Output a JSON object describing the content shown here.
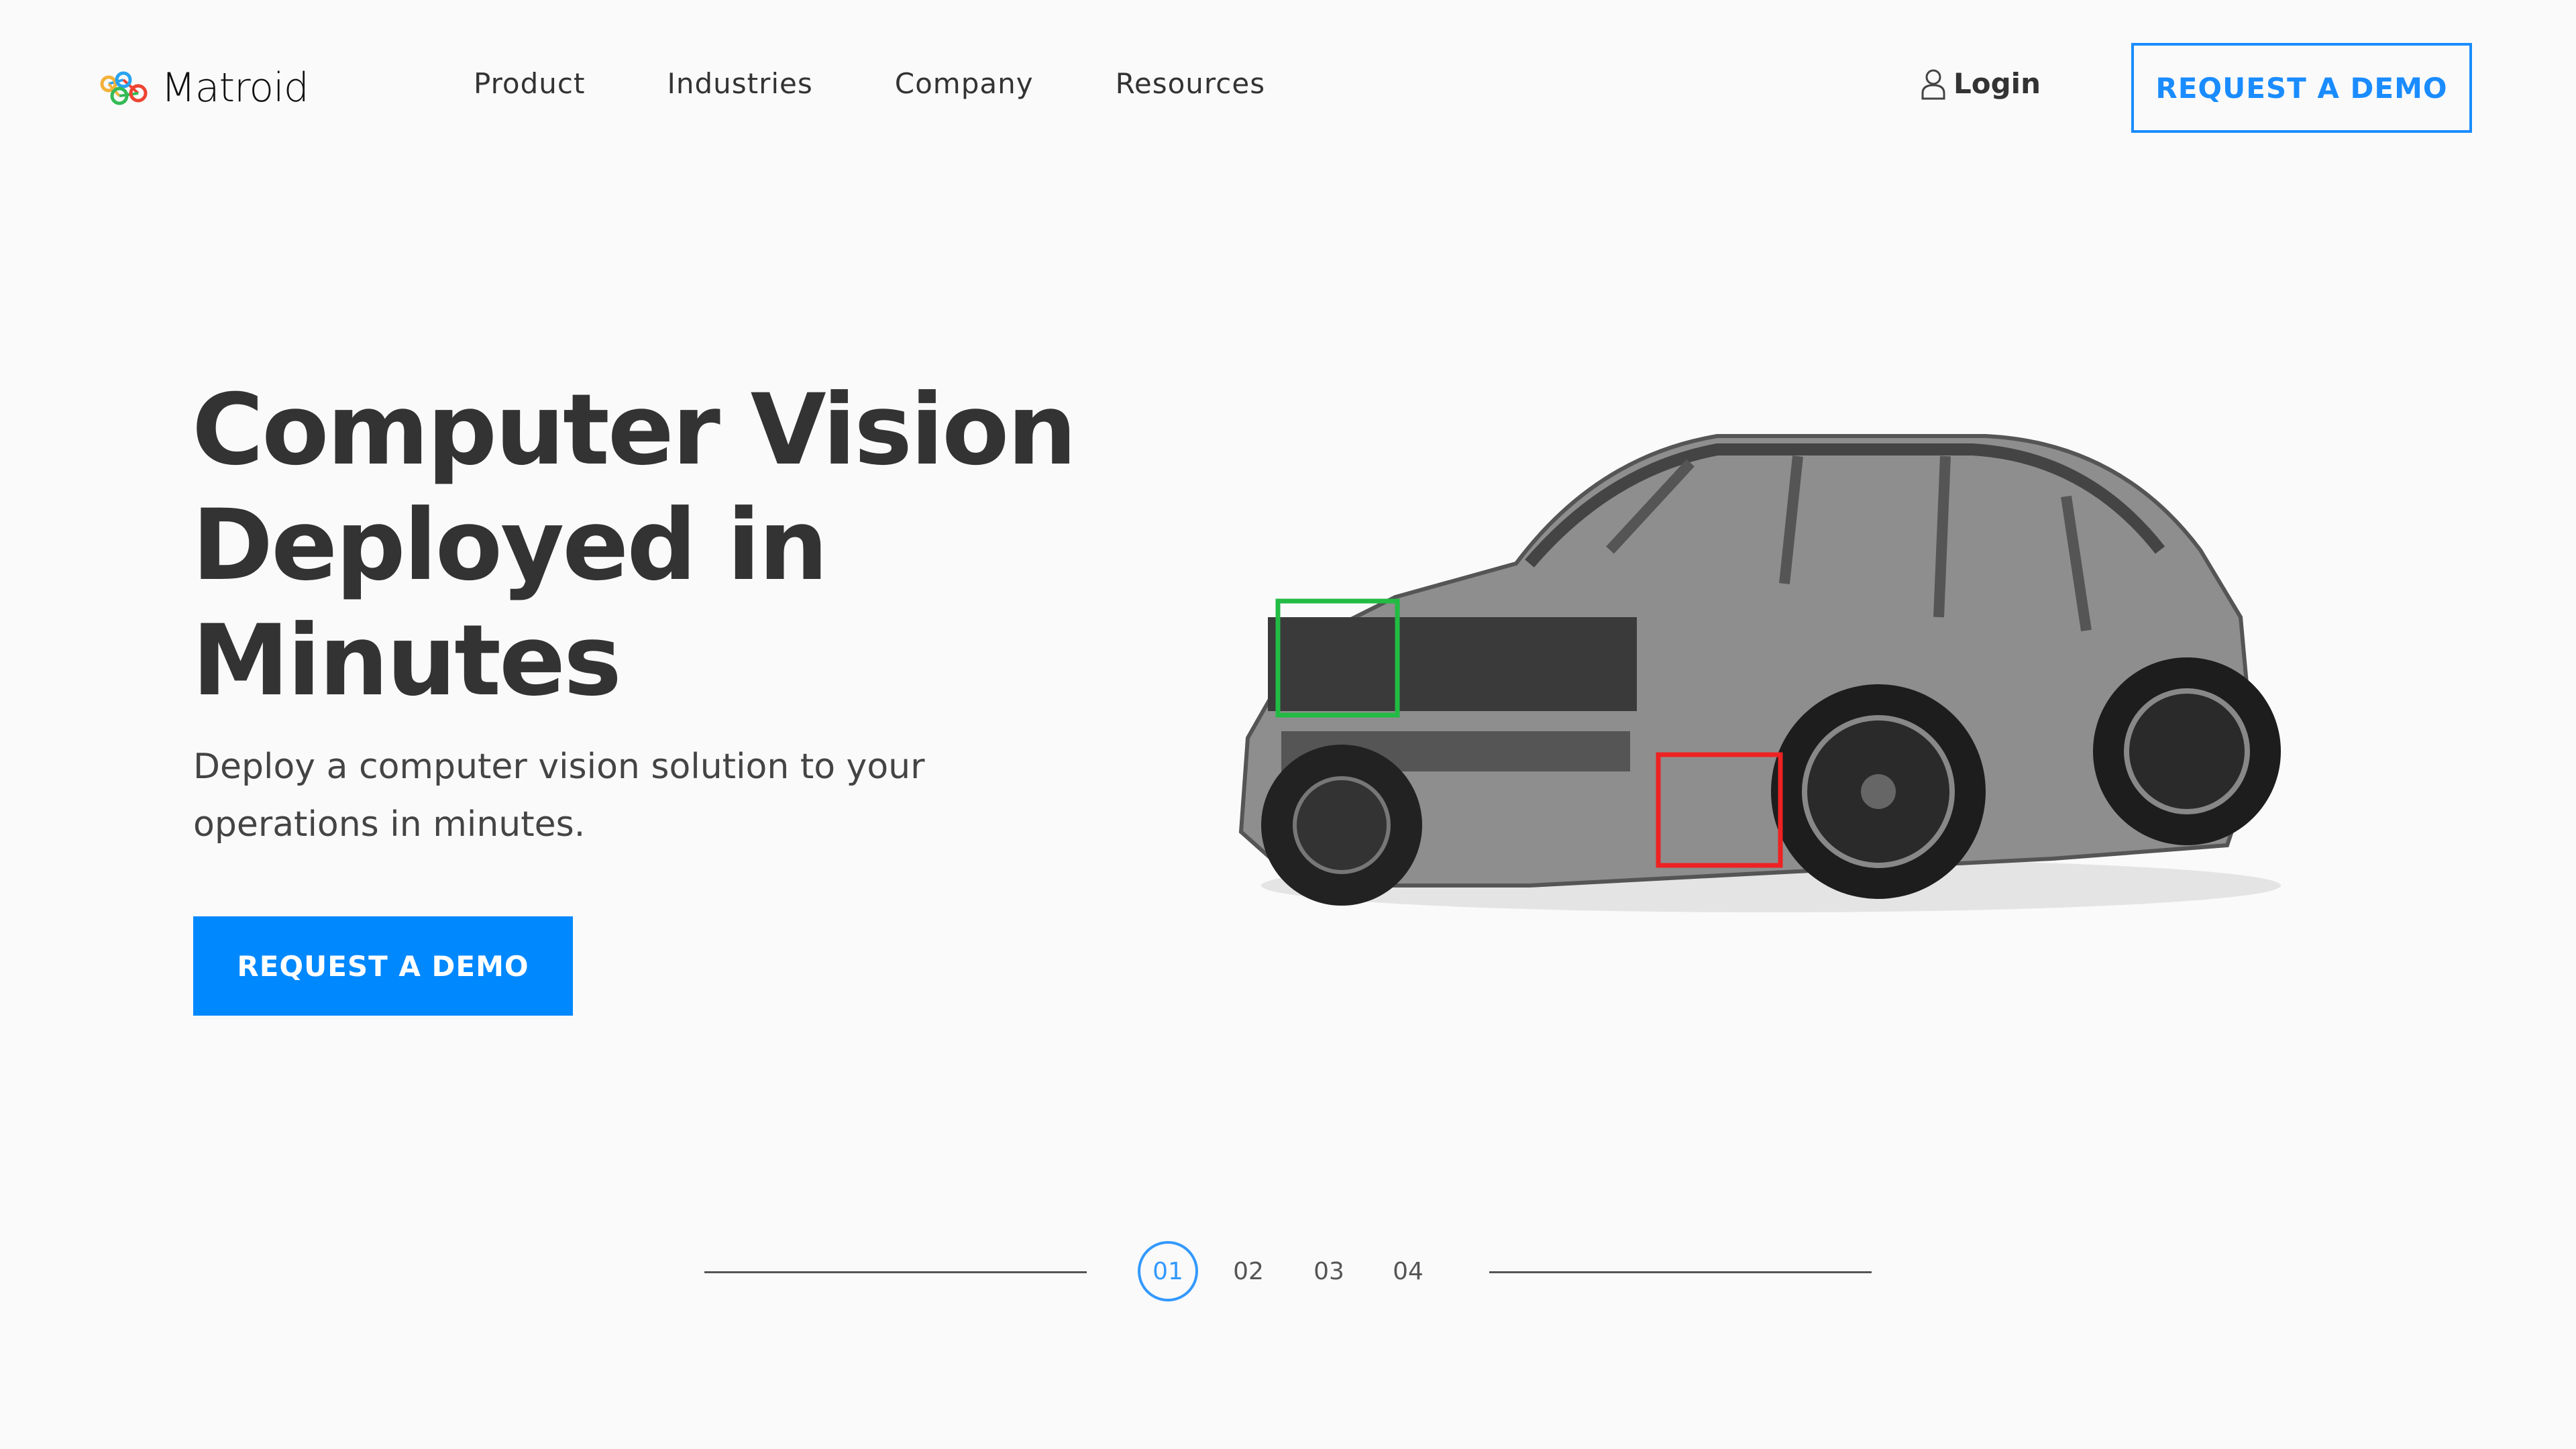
{
  "brand": {
    "name": "Matroid",
    "accent": "#0088ff"
  },
  "nav": {
    "items": [
      {
        "label": "Product"
      },
      {
        "label": "Industries"
      },
      {
        "label": "Company"
      },
      {
        "label": "Resources"
      }
    ]
  },
  "header": {
    "login_label": "Login",
    "login_icon": "user-icon",
    "cta_label": "REQUEST A DEMO"
  },
  "hero": {
    "title_lines": [
      "Computer Vision",
      "Deployed in",
      "Minutes"
    ],
    "subtitle": "Deploy a computer vision solution to your operations in minutes.",
    "cta_label": "REQUEST A DEMO",
    "image_alt": "car chassis with detection boxes",
    "detections": [
      {
        "color": "#22bb44"
      },
      {
        "color": "#ee2222"
      }
    ]
  },
  "pager": {
    "items": [
      "01",
      "02",
      "03",
      "04"
    ],
    "active_index": 0
  }
}
